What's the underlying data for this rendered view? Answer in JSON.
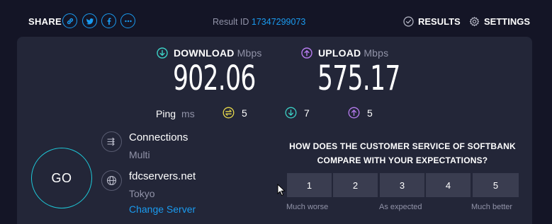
{
  "header": {
    "share_label": "SHARE",
    "share_icons": [
      "link-icon",
      "twitter-icon",
      "facebook-icon",
      "more-icon"
    ],
    "result_id_label": "Result ID",
    "result_id": "17347299073",
    "results_label": "RESULTS",
    "settings_label": "SETTINGS"
  },
  "download": {
    "label": "DOWNLOAD",
    "unit": "Mbps",
    "value": "902.06",
    "accent": "#3cd1c6"
  },
  "upload": {
    "label": "UPLOAD",
    "unit": "Mbps",
    "value": "575.17",
    "accent": "#b77cf0"
  },
  "ping": {
    "label": "Ping",
    "unit": "ms",
    "idle": "5",
    "download": "7",
    "upload": "5",
    "idle_color": "#e6d84a"
  },
  "go": {
    "label": "GO"
  },
  "connections": {
    "title": "Connections",
    "mode": "Multi"
  },
  "server": {
    "name": "fdcservers.net",
    "location": "Tokyo",
    "change_label": "Change Server"
  },
  "survey": {
    "question_line1": "HOW DOES THE CUSTOMER SERVICE OF SOFTBANK",
    "question_line2": "COMPARE WITH YOUR EXPECTATIONS?",
    "options": [
      "1",
      "2",
      "3",
      "4",
      "5"
    ],
    "low_label": "Much worse",
    "mid_label": "As expected",
    "high_label": "Much better"
  },
  "colors": {
    "background": "#141526",
    "card": "#232638",
    "accent_blue": "#1a9bf0",
    "go_ring": "#1ec8d8"
  }
}
